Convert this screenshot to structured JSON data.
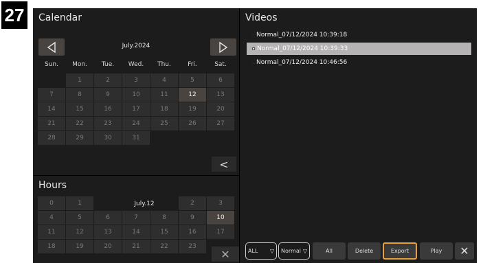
{
  "step_number": "27",
  "calendar": {
    "title": "Calendar",
    "month_label": "July.2024",
    "prev_icon": "triangle-left-icon",
    "next_icon": "triangle-right-icon",
    "weekdays": [
      "Sun.",
      "Mon.",
      "Tue.",
      "Wed.",
      "Thu.",
      "Fri.",
      "Sat."
    ],
    "days": [
      [
        "",
        "1",
        "2",
        "3",
        "4",
        "5",
        "6"
      ],
      [
        "7",
        "8",
        "9",
        "10",
        "11",
        "12",
        "13"
      ],
      [
        "14",
        "15",
        "16",
        "17",
        "18",
        "19",
        "20"
      ],
      [
        "21",
        "22",
        "23",
        "24",
        "25",
        "26",
        "27"
      ],
      [
        "28",
        "29",
        "30",
        "31",
        "",
        "",
        ""
      ]
    ],
    "selected_day": "12",
    "back_icon": "chevron-left-icon",
    "back_glyph": "<"
  },
  "hours": {
    "title": "Hours",
    "date_label": "July.12",
    "rows": [
      [
        "0",
        "1",
        "",
        "",
        "",
        "2",
        "3"
      ],
      [
        "4",
        "5",
        "6",
        "7",
        "8",
        "9",
        "10"
      ],
      [
        "11",
        "12",
        "13",
        "14",
        "15",
        "16",
        "17"
      ],
      [
        "18",
        "19",
        "20",
        "21",
        "22",
        "23",
        ""
      ]
    ],
    "selected_hour": "10",
    "close_icon": "close-icon",
    "close_glyph": "✕"
  },
  "videos": {
    "title": "Videos",
    "items": [
      "Normal_07/12/2024 10:39:18",
      "Normal_07/12/2024 10:39:33",
      "Normal_07/12/2024 10:46:56"
    ],
    "selected_index": 1
  },
  "toolbar": {
    "filter_all": "ALL",
    "filter_type": "Normal",
    "dropdown_icon": "triangle-down-icon",
    "all_label": "All",
    "delete_label": "Delete",
    "export_label": "Export",
    "play_label": "Play",
    "close_icon": "close-icon",
    "close_glyph": "✕",
    "accent_color": "#e8a13a"
  }
}
